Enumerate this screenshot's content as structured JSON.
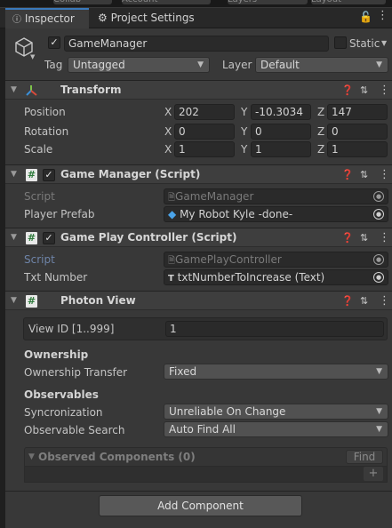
{
  "topbar": {
    "buttons": [
      "Collab",
      "Account",
      "Layers",
      "Layout"
    ]
  },
  "tabs": [
    {
      "label": "Inspector",
      "active": true,
      "icon": "info-icon"
    },
    {
      "label": "Project Settings",
      "active": false,
      "icon": "gear-icon"
    }
  ],
  "gameobject": {
    "name": "GameManager",
    "active": true,
    "static_label": "Static",
    "tag_label": "Tag",
    "tag_value": "Untagged",
    "layer_label": "Layer",
    "layer_value": "Default"
  },
  "transform": {
    "title": "Transform",
    "rows": [
      {
        "label": "Position",
        "x": "202",
        "y": "-10.3034",
        "z": "147"
      },
      {
        "label": "Rotation",
        "x": "0",
        "y": "0",
        "z": "0"
      },
      {
        "label": "Scale",
        "x": "1",
        "y": "1",
        "z": "1"
      }
    ],
    "axes": [
      "X",
      "Y",
      "Z"
    ]
  },
  "game_manager": {
    "title": "Game Manager (Script)",
    "enabled": true,
    "script_label": "Script",
    "script_value": "GameManager",
    "prefab_label": "Player Prefab",
    "prefab_value": "My Robot Kyle -done-"
  },
  "game_play_controller": {
    "title": "Game Play Controller (Script)",
    "enabled": true,
    "script_label": "Script",
    "script_value": "GamePlayController",
    "txt_label": "Txt Number",
    "txt_value": "txtNumberToIncrease (Text)"
  },
  "photon_view": {
    "title": "Photon View",
    "view_id_label": "View ID [1..999]",
    "view_id_value": "1",
    "ownership_heading": "Ownership",
    "ownership_transfer_label": "Ownership Transfer",
    "ownership_transfer_value": "Fixed",
    "observables_heading": "Observables",
    "sync_label": "Syncronization",
    "sync_value": "Unreliable On Change",
    "search_label": "Observable Search",
    "search_value": "Auto Find All",
    "observed_label": "Observed Components (0)",
    "find_label": "Find",
    "plus_label": "+"
  },
  "add_component_label": "Add Component",
  "colors": {
    "accent": "#3a79bb",
    "background": "#383838",
    "field": "#2a2a2a",
    "header": "#3e3e3e"
  }
}
